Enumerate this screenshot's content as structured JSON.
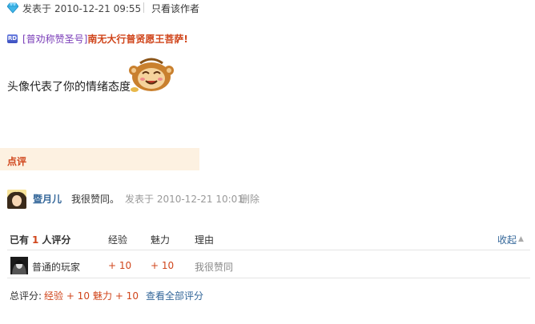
{
  "post": {
    "posted_label": "发表于",
    "posted_time": "2010-12-21 09:55",
    "only_author": "只看该作者"
  },
  "signature": {
    "badge": "RD",
    "bracket_text": "[普劝称赞圣号]",
    "main_text": "南无大行普贤愿王菩萨!"
  },
  "body": {
    "text": "头像代表了你的情绪态度"
  },
  "dianping": {
    "label": "点评"
  },
  "comment": {
    "user": "暨月儿",
    "text": "我很赞同。",
    "time": "发表于 2010-12-21 10:01",
    "delete_label": "删除"
  },
  "rating": {
    "prefix": "已有",
    "count": "1",
    "suffix": "人评分",
    "col_exp": "经验",
    "col_charm": "魅力",
    "col_reason": "理由",
    "collapse": "收起",
    "rows": [
      {
        "user": "普通的玩家",
        "exp": "+ 10",
        "charm": "+ 10",
        "reason": "我很赞同"
      }
    ],
    "total_label": "总评分:",
    "total_exp": "经验 + 10",
    "total_charm": "魅力 + 10",
    "view_all": "查看全部评分"
  },
  "colors": {
    "accent": "#d0451b",
    "link": "#336699",
    "dianping_bg": "#fdf1e1"
  },
  "icons": {
    "diamond": "diamond-icon",
    "monkey": "monkey-emoticon",
    "collapse_arrow": "triangle-up-icon"
  }
}
